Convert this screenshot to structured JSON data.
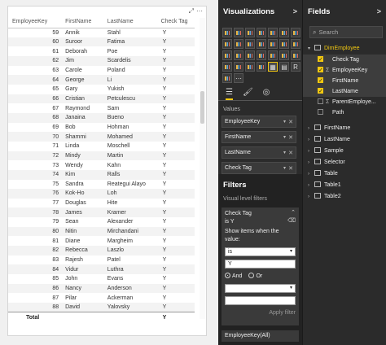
{
  "table": {
    "columns": [
      "EmployeeKey",
      "FirstName",
      "LastName",
      "Check Tag"
    ],
    "rows": [
      [
        "59",
        "Annik",
        "Stahl",
        "Y"
      ],
      [
        "60",
        "Suroor",
        "Fatima",
        "Y"
      ],
      [
        "61",
        "Deborah",
        "Poe",
        "Y"
      ],
      [
        "62",
        "Jim",
        "Scardelis",
        "Y"
      ],
      [
        "63",
        "Carole",
        "Poland",
        "Y"
      ],
      [
        "64",
        "George",
        "Li",
        "Y"
      ],
      [
        "65",
        "Gary",
        "Yukish",
        "Y"
      ],
      [
        "66",
        "Cristian",
        "Petculescu",
        "Y"
      ],
      [
        "67",
        "Raymond",
        "Sam",
        "Y"
      ],
      [
        "68",
        "Janaina",
        "Bueno",
        "Y"
      ],
      [
        "69",
        "Bob",
        "Hohman",
        "Y"
      ],
      [
        "70",
        "Shammi",
        "Mohamed",
        "Y"
      ],
      [
        "71",
        "Linda",
        "Moschell",
        "Y"
      ],
      [
        "72",
        "Mindy",
        "Martin",
        "Y"
      ],
      [
        "73",
        "Wendy",
        "Kahn",
        "Y"
      ],
      [
        "74",
        "Kim",
        "Ralls",
        "Y"
      ],
      [
        "75",
        "Sandra",
        "Reategui Alayo",
        "Y"
      ],
      [
        "76",
        "Kok-Ho",
        "Loh",
        "Y"
      ],
      [
        "77",
        "Douglas",
        "Hite",
        "Y"
      ],
      [
        "78",
        "James",
        "Kramer",
        "Y"
      ],
      [
        "79",
        "Sean",
        "Alexander",
        "Y"
      ],
      [
        "80",
        "Nitin",
        "Mirchandani",
        "Y"
      ],
      [
        "81",
        "Diane",
        "Margheim",
        "Y"
      ],
      [
        "82",
        "Rebecca",
        "Laszlo",
        "Y"
      ],
      [
        "83",
        "Rajesh",
        "Patel",
        "Y"
      ],
      [
        "84",
        "Vidur",
        "Luthra",
        "Y"
      ],
      [
        "85",
        "John",
        "Evans",
        "Y"
      ],
      [
        "86",
        "Nancy",
        "Anderson",
        "Y"
      ],
      [
        "87",
        "Pilar",
        "Ackerman",
        "Y"
      ],
      [
        "88",
        "David",
        "Yalovsky",
        "Y"
      ]
    ],
    "total_label": "Total",
    "total_check": "Y"
  },
  "viz": {
    "title": "Visualizations",
    "chevron": ">",
    "values_label": "Values",
    "wells": [
      "EmployeeKey",
      "FirstName",
      "LastName",
      "Check Tag"
    ],
    "filters_title": "Filters",
    "visual_level_label": "Visual level filters",
    "filter_card": {
      "field": "Check Tag",
      "condition": "is Y",
      "show_items": "Show items when the value:",
      "operator": "is",
      "value": "Y",
      "and_label": "And",
      "or_label": "Or",
      "apply": "Apply filter"
    },
    "filter2": "EmployeeKey(All)"
  },
  "fields": {
    "title": "Fields",
    "chevron": ">",
    "search_placeholder": "Search",
    "open_table": "DimEmployee",
    "open_fields": [
      "Check Tag",
      "EmployeeKey",
      "FirstName",
      "LastName",
      "ParentEmploye...",
      "Path"
    ],
    "tables": [
      "FirstName",
      "LastName",
      "Sample",
      "Selector",
      "Table",
      "Table1",
      "Table2"
    ]
  },
  "colors": {
    "accent": "#f2c811",
    "pane_bg": "#2b2b2b"
  }
}
